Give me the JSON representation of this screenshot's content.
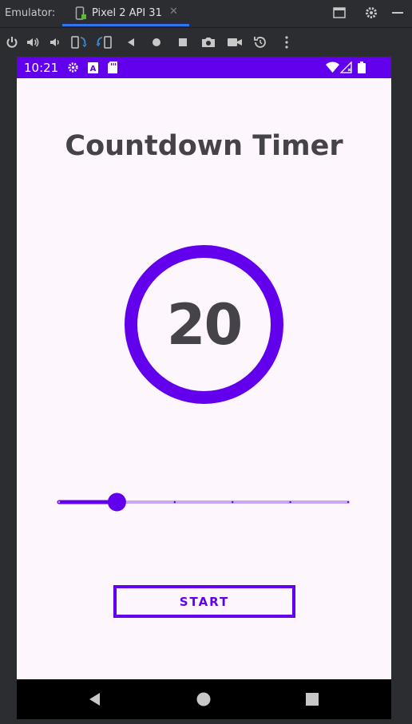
{
  "emulator": {
    "label": "Emulator:",
    "tab_title": "Pixel 2 API 31",
    "tab_close": "✕",
    "accent_color": "#3574f0"
  },
  "toolbar": {
    "icons": [
      "power-icon",
      "volume-up-icon",
      "volume-down-icon",
      "rotate-left-icon",
      "rotate-right-icon",
      "back-icon",
      "home-icon",
      "overview-icon",
      "screenshot-icon",
      "screen-record-icon",
      "snapshot-icon",
      "more-icon"
    ]
  },
  "statusbar": {
    "time": "10:21",
    "color": "#6200ee"
  },
  "app": {
    "title": "Countdown Timer",
    "timer_value": "20",
    "start_label": "START",
    "primary_color": "#6200ee",
    "text_color": "#45424a",
    "background": "#fdf7fd"
  },
  "slider": {
    "value": 1,
    "steps": 5,
    "min": 0,
    "max": 5
  }
}
